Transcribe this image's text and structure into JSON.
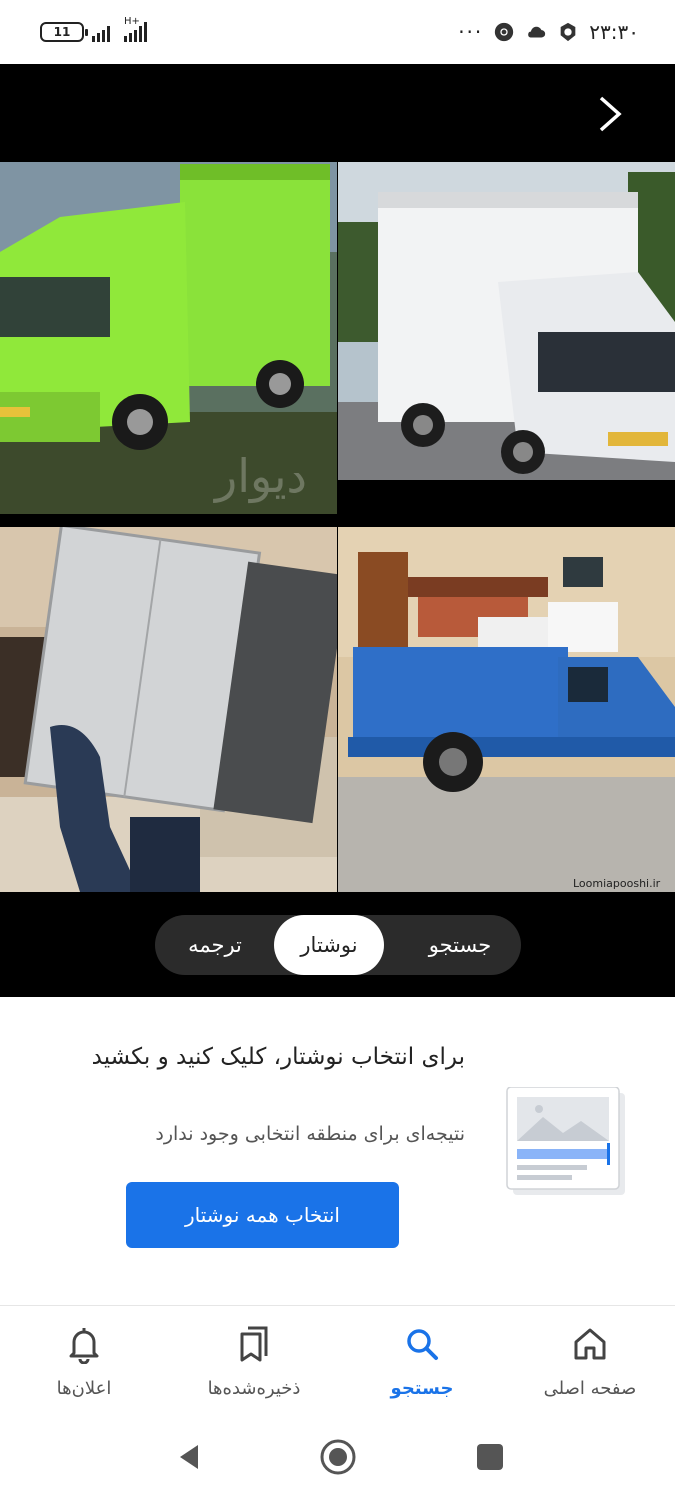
{
  "status_bar": {
    "battery": "11",
    "network": "H+",
    "dots": "···",
    "time": "۲۳:۳۰"
  },
  "viewer": {
    "photos": [
      {
        "name": "green-truck-photo",
        "watermark": "دیوار"
      },
      {
        "name": "white-truck-photo"
      },
      {
        "name": "fridge-carrier-photo"
      },
      {
        "name": "blue-pickup-photo",
        "watermark": "Loomiapooshi.ir"
      }
    ],
    "modes": {
      "translate": "ترجمه",
      "text": "نوشتار",
      "search": "جستجو"
    }
  },
  "panel": {
    "title": "برای انتخاب نوشتار، کلیک کنید و بکشید",
    "subtitle": "نتیجه‌ای برای منطقه انتخابی وجود ندارد",
    "select_all_label": "انتخاب همه نوشتار"
  },
  "bottom_nav": {
    "home": "صفحه اصلی",
    "search": "جستجو",
    "saved": "ذخیره‌شده‌ها",
    "notifications": "اعلان‌ها"
  },
  "colors": {
    "accent": "#1a73e8",
    "viewer_bg": "#000000"
  }
}
